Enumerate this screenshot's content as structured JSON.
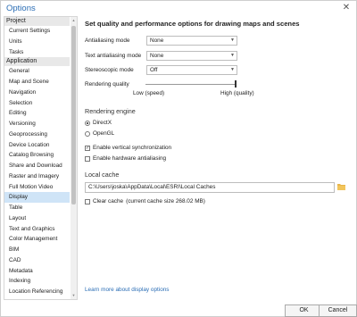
{
  "window": {
    "title": "Options",
    "close": "✕"
  },
  "sidebar": {
    "group1": "Project",
    "group1_items": [
      "Current Settings",
      "Units",
      "Tasks"
    ],
    "group2": "Application",
    "group2_items": [
      "General",
      "Map and Scene",
      "Navigation",
      "Selection",
      "Editing",
      "Versioning",
      "Geoprocessing",
      "Device Location",
      "Catalog Browsing",
      "Share and Download",
      "Raster and Imagery",
      "Full Motion Video",
      "Display",
      "Table",
      "Layout",
      "Text and Graphics",
      "Color Management",
      "BIM",
      "CAD",
      "Metadata",
      "Indexing",
      "Location Referencing"
    ],
    "selected": "Display"
  },
  "main": {
    "heading": "Set quality and performance options for drawing maps and scenes",
    "antialiasing_label": "Antialiasing mode",
    "antialiasing_value": "None",
    "text_antialiasing_label": "Text antialiasing mode",
    "text_antialiasing_value": "None",
    "stereoscopic_label": "Stereoscopic mode",
    "stereoscopic_value": "Off",
    "rendering_quality_label": "Rendering quality",
    "rendering_quality_level": 1.0,
    "low_label": "Low (speed)",
    "high_label": "High (quality)",
    "rendering_engine_label": "Rendering engine",
    "directx_label": "DirectX",
    "opengl_label": "OpenGL",
    "vsync_label": "Enable vertical synchronization",
    "hw_antialias_label": "Enable hardware antialiasing",
    "local_cache_label": "Local cache",
    "cache_path": "C:\\Users\\joska\\AppData\\Local\\ESRI\\Local Caches",
    "clear_cache_label": "Clear cache",
    "cache_size_text": "(current cache size 268.02 MB)",
    "learn_more": "Learn more about display options"
  },
  "buttons": {
    "ok": "OK",
    "cancel": "Cancel"
  },
  "colors": {
    "accent": "#2a6db5",
    "selected": "#cfe4f7"
  }
}
